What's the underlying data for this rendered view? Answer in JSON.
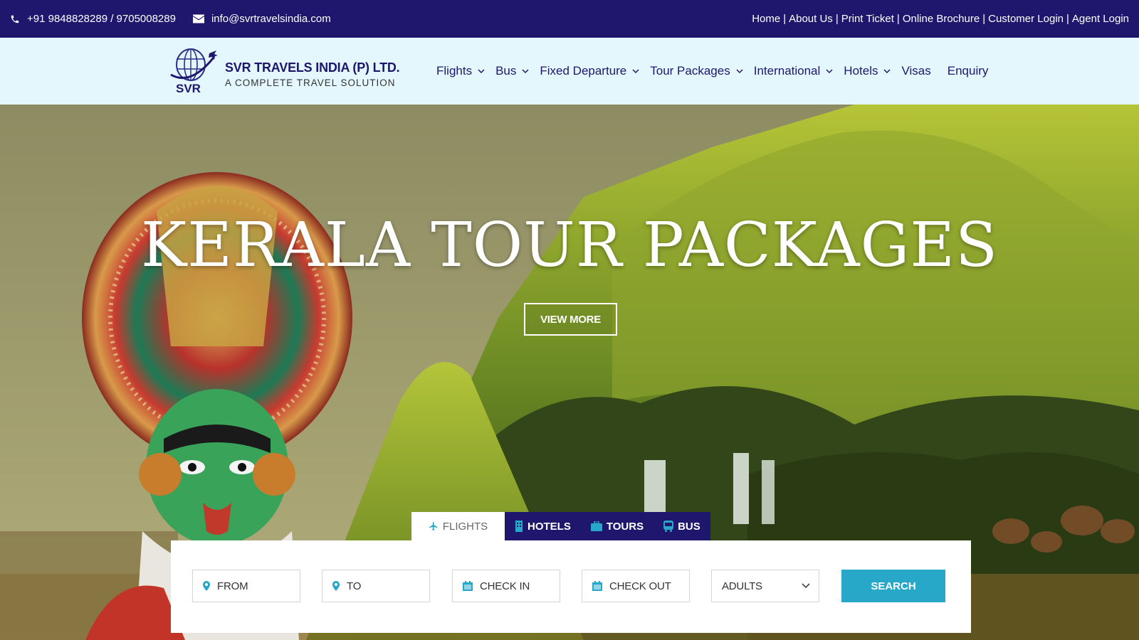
{
  "topbar": {
    "phone": "+91 9848828289 / 9705008289",
    "email": "info@svrtravelsindia.com",
    "links": [
      "Home",
      "About Us",
      "Print Ticket",
      "Online Brochure",
      "Customer Login",
      "Agent Login"
    ]
  },
  "header": {
    "logo_mark": "SVR",
    "company_name": "SVR TRAVELS INDIA (P) LTD.",
    "tagline": "A COMPLETE TRAVEL SOLUTION",
    "nav": [
      {
        "label": "Flights",
        "dropdown": true
      },
      {
        "label": "Bus",
        "dropdown": true
      },
      {
        "label": "Fixed Departure",
        "dropdown": true
      },
      {
        "label": "Tour Packages",
        "dropdown": true
      },
      {
        "label": "International",
        "dropdown": true
      },
      {
        "label": "Hotels",
        "dropdown": true
      },
      {
        "label": "Visas",
        "dropdown": false
      },
      {
        "label": "Enquiry",
        "dropdown": false
      }
    ]
  },
  "hero": {
    "title": "KERALA TOUR PACKAGES",
    "cta": "VIEW MORE"
  },
  "search": {
    "tabs": [
      {
        "label": "FLIGHTS",
        "icon": "plane-icon",
        "active": true
      },
      {
        "label": "HOTELS",
        "icon": "building-icon",
        "active": false
      },
      {
        "label": "TOURS",
        "icon": "suitcase-icon",
        "active": false
      },
      {
        "label": "BUS",
        "icon": "bus-icon",
        "active": false
      }
    ],
    "from": "FROM",
    "to": "TO",
    "check_in": "CHECK IN",
    "check_out": "CHECK OUT",
    "adults": "ADULTS",
    "button": "SEARCH"
  },
  "colors": {
    "navy": "#1f176e",
    "header_bg": "#e3f7fd",
    "search_button": "#28a8c8"
  }
}
